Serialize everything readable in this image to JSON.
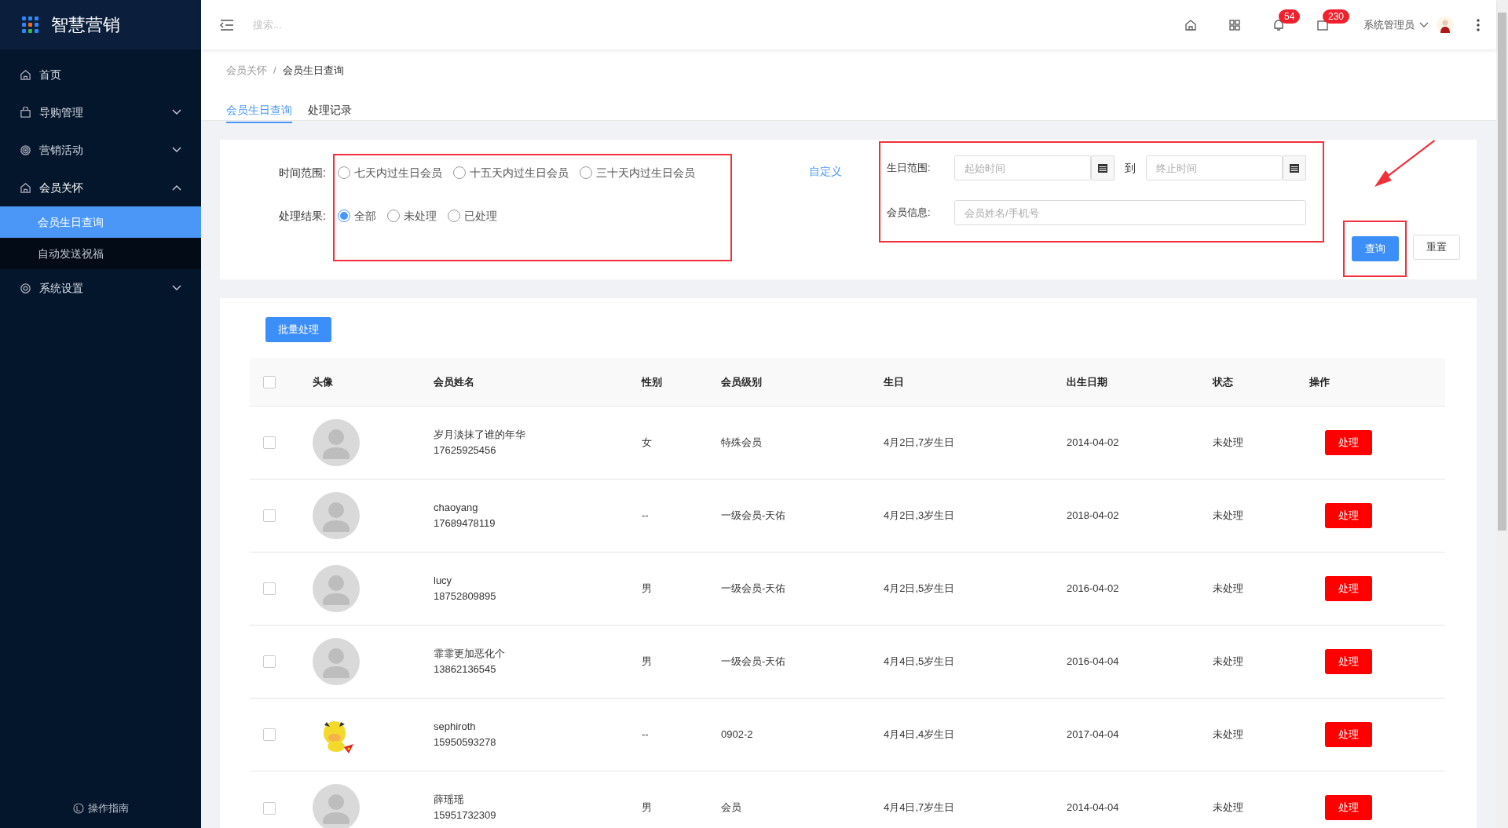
{
  "app": {
    "title": "智慧营销"
  },
  "sidebar": {
    "items": [
      {
        "label": "首页",
        "kind": "link"
      },
      {
        "label": "导购管理",
        "kind": "group",
        "expanded": false
      },
      {
        "label": "营销活动",
        "kind": "group",
        "expanded": false
      },
      {
        "label": "会员关怀",
        "kind": "group",
        "expanded": true,
        "children": [
          {
            "label": "会员生日查询",
            "selected": true
          },
          {
            "label": "自动发送祝福",
            "selected": false
          }
        ]
      },
      {
        "label": "系统设置",
        "kind": "group",
        "expanded": false
      }
    ],
    "footer": "操作指南"
  },
  "header": {
    "search": {
      "placeholder": "搜索..."
    },
    "notifications": "54",
    "messages": "230",
    "user": "系统管理员"
  },
  "breadcrumb": [
    "会员关怀",
    "会员生日查询"
  ],
  "breadcrumb_separator": "/",
  "tabs": [
    {
      "label": "会员生日查询",
      "selected": true
    },
    {
      "label": "处理记录",
      "selected": false
    }
  ],
  "filters": {
    "time_range": {
      "label": "时间范围:",
      "options": [
        {
          "label": "七天内过生日会员",
          "selected": false
        },
        {
          "label": "十五天内过生日会员",
          "selected": false
        },
        {
          "label": "三十天内过生日会员",
          "selected": false
        }
      ]
    },
    "process_result": {
      "label": "处理结果:",
      "options": [
        {
          "label": "全部",
          "selected": true
        },
        {
          "label": "未处理",
          "selected": false
        },
        {
          "label": "已处理",
          "selected": false
        }
      ]
    },
    "options_highlighted": true,
    "custom_link": "自定义",
    "birthday_range": {
      "label": "生日范围:",
      "start_placeholder": "起始时间",
      "separator": "到",
      "end_placeholder": "终止时间"
    },
    "member_info": {
      "label": "会员信息:",
      "placeholder": "会员姓名/手机号"
    },
    "fields_highlighted": true,
    "query_button": "查询",
    "query_highlighted": true,
    "pointer_arrow": true,
    "reset_button": "重置"
  },
  "table": {
    "batch_button": "批量处理",
    "select_all_checked": false,
    "columns": [
      "头像",
      "会员姓名",
      "性别",
      "会员级别",
      "生日",
      "出生日期",
      "状态",
      "操作"
    ],
    "rows": [
      {
        "checked": false,
        "avatar": {
          "kind": "default"
        },
        "name": "岁月淡抹了谁的年华",
        "phone": "17625925456",
        "gender": "女",
        "level": "特殊会员",
        "birthday": "4月2日,7岁生日",
        "birth_date": "2014-04-02",
        "status": "未处理",
        "action": "处理"
      },
      {
        "checked": false,
        "avatar": {
          "kind": "default"
        },
        "name": "chaoyang",
        "phone": "17689478119",
        "gender": "--",
        "level": "一级会员-天佑",
        "birthday": "4月2日,3岁生日",
        "birth_date": "2018-04-02",
        "status": "未处理",
        "action": "处理"
      },
      {
        "checked": false,
        "avatar": {
          "kind": "default"
        },
        "name": "lucy",
        "phone": "18752809895",
        "gender": "男",
        "level": "一级会员-天佑",
        "birthday": "4月2日,5岁生日",
        "birth_date": "2016-04-02",
        "status": "未处理",
        "action": "处理"
      },
      {
        "checked": false,
        "avatar": {
          "kind": "default"
        },
        "name": "霏霏更加恶化个",
        "phone": "13862136545",
        "gender": "男",
        "level": "一级会员-天佑",
        "birthday": "4月4日,5岁生日",
        "birth_date": "2016-04-04",
        "status": "未处理",
        "action": "处理"
      },
      {
        "checked": false,
        "name": "sephiroth",
        "phone": "15950593278",
        "gender": "--",
        "level": "0902-2",
        "birthday": "4月4日,4岁生日",
        "birth_date": "2017-04-04",
        "status": "未处理",
        "action": "处理"
      },
      {
        "checked": false,
        "avatar": {
          "kind": "default"
        },
        "name": "薛瑶瑶",
        "phone": "15951732309",
        "gender": "男",
        "level": "会员",
        "birthday": "4月4日,7岁生日",
        "birth_date": "2014-04-04",
        "status": "未处理",
        "action": "处理"
      }
    ]
  }
}
